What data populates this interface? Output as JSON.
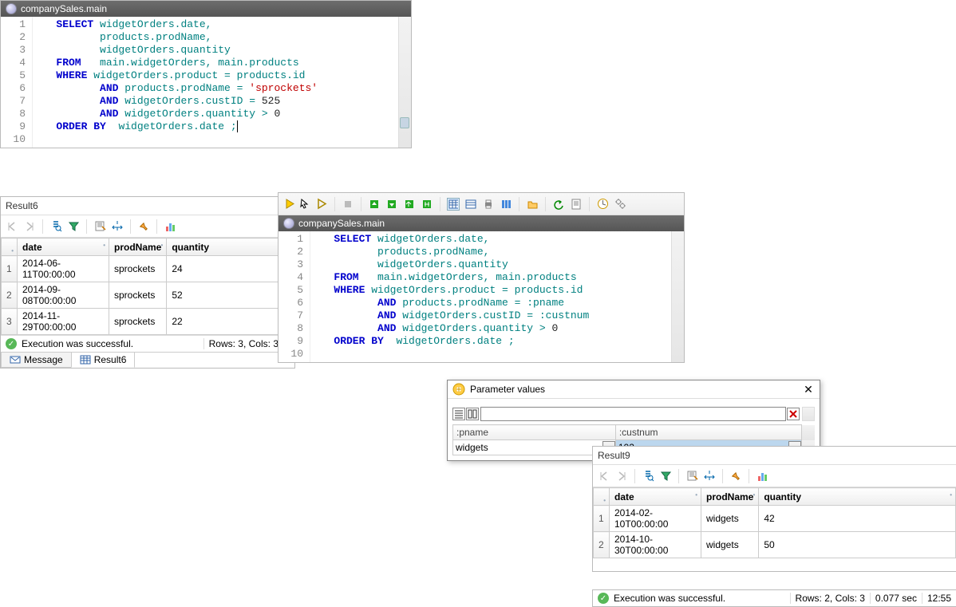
{
  "editor1": {
    "title": "companySales.main",
    "lines": [
      "1",
      "2",
      "3",
      "4",
      "5",
      "6",
      "7",
      "8",
      "9",
      "10"
    ],
    "code": {
      "l1": {
        "select": "SELECT",
        "c1": "widgetOrders.date,"
      },
      "l2": {
        "c1": "products.prodName,"
      },
      "l3": {
        "c1": "widgetOrders.quantity"
      },
      "l4": {
        "from": "FROM",
        "c1": "main.widgetOrders, main.products"
      },
      "l5": {
        "where": "WHERE",
        "c1": "widgetOrders.product = products.id"
      },
      "l6": {
        "and": "AND",
        "c1": "products.prodName =",
        "str": "'sprockets'"
      },
      "l7": {
        "and": "AND",
        "c1": "widgetOrders.custID =",
        "num": "525"
      },
      "l8": {
        "and": "AND",
        "c1": "widgetOrders.quantity >",
        "num": "0"
      },
      "l9": {
        "order": "ORDER BY",
        "c1": " widgetOrders.date ;"
      }
    }
  },
  "result6": {
    "label": "Result6",
    "cols": {
      "c1": "date",
      "c2": "prodName",
      "c3": "quantity"
    },
    "rows": [
      {
        "n": "1",
        "date": "2014-06-11T00:00:00",
        "prodName": "sprockets",
        "quantity": "24"
      },
      {
        "n": "2",
        "date": "2014-09-08T00:00:00",
        "prodName": "sprockets",
        "quantity": "52"
      },
      {
        "n": "3",
        "date": "2014-11-29T00:00:00",
        "prodName": "sprockets",
        "quantity": "22"
      }
    ],
    "status": "Execution was successful.",
    "rowscols": "Rows: 3, Cols: 3",
    "tabs": {
      "message": "Message",
      "result": "Result6"
    }
  },
  "editor2": {
    "title": "companySales.main",
    "lines": [
      "1",
      "2",
      "3",
      "4",
      "5",
      "6",
      "7",
      "8",
      "9",
      "10"
    ],
    "code": {
      "l1": {
        "select": "SELECT",
        "c1": "widgetOrders.date,"
      },
      "l2": {
        "c1": "products.prodName,"
      },
      "l3": {
        "c1": "widgetOrders.quantity"
      },
      "l4": {
        "from": "FROM",
        "c1": "main.widgetOrders, main.products"
      },
      "l5": {
        "where": "WHERE",
        "c1": "widgetOrders.product = products.id"
      },
      "l6": {
        "and": "AND",
        "c1": "products.prodName = :pname"
      },
      "l7": {
        "and": "AND",
        "c1": "widgetOrders.custID = :custnum"
      },
      "l8": {
        "and": "AND",
        "c1": "widgetOrders.quantity >",
        "num": "0"
      },
      "l9": {
        "order": "ORDER BY",
        "c1": " widgetOrders.date ;"
      }
    }
  },
  "params": {
    "title": "Parameter values",
    "col1": ":pname",
    "col2": ":custnum",
    "val1": "widgets",
    "val2": "102"
  },
  "result9": {
    "label": "Result9",
    "cols": {
      "c1": "date",
      "c2": "prodName",
      "c3": "quantity"
    },
    "rows": [
      {
        "n": "1",
        "date": "2014-02-10T00:00:00",
        "prodName": "widgets",
        "quantity": "42"
      },
      {
        "n": "2",
        "date": "2014-10-30T00:00:00",
        "prodName": "widgets",
        "quantity": "50"
      }
    ],
    "status": "Execution was successful.",
    "rowscols": "Rows: 2, Cols: 3",
    "timing": "0.077 sec",
    "clock": "12:55"
  }
}
